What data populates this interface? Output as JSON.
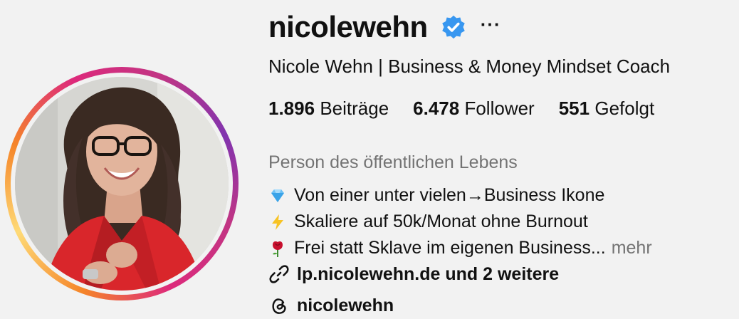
{
  "profile": {
    "username": "nicolewehn",
    "more_label": "···",
    "full_name": "Nicole Wehn | Business & Money Mindset Coach",
    "accent_color": "#3897f0"
  },
  "stats": [
    {
      "value": "1.896",
      "label": "Beiträge"
    },
    {
      "value": "6.478",
      "label": "Follower"
    },
    {
      "value": "551",
      "label": "Gefolgt"
    }
  ],
  "category": "Person des öffentlichen Lebens",
  "bio": [
    {
      "icon": "diamond-emoji",
      "text": "Von einer unter vielen→Business Ikone"
    },
    {
      "icon": "lightning-emoji",
      "text": "Skaliere auf 50k/Monat ohne Burnout"
    },
    {
      "icon": "rose-emoji",
      "text": "Frei statt Sklave im eigenen Business...",
      "more": "mehr"
    }
  ],
  "link": {
    "icon": "link-icon",
    "text": "lp.nicolewehn.de und 2 weitere"
  },
  "threads": {
    "icon": "threads-icon",
    "text": "nicolewehn"
  }
}
